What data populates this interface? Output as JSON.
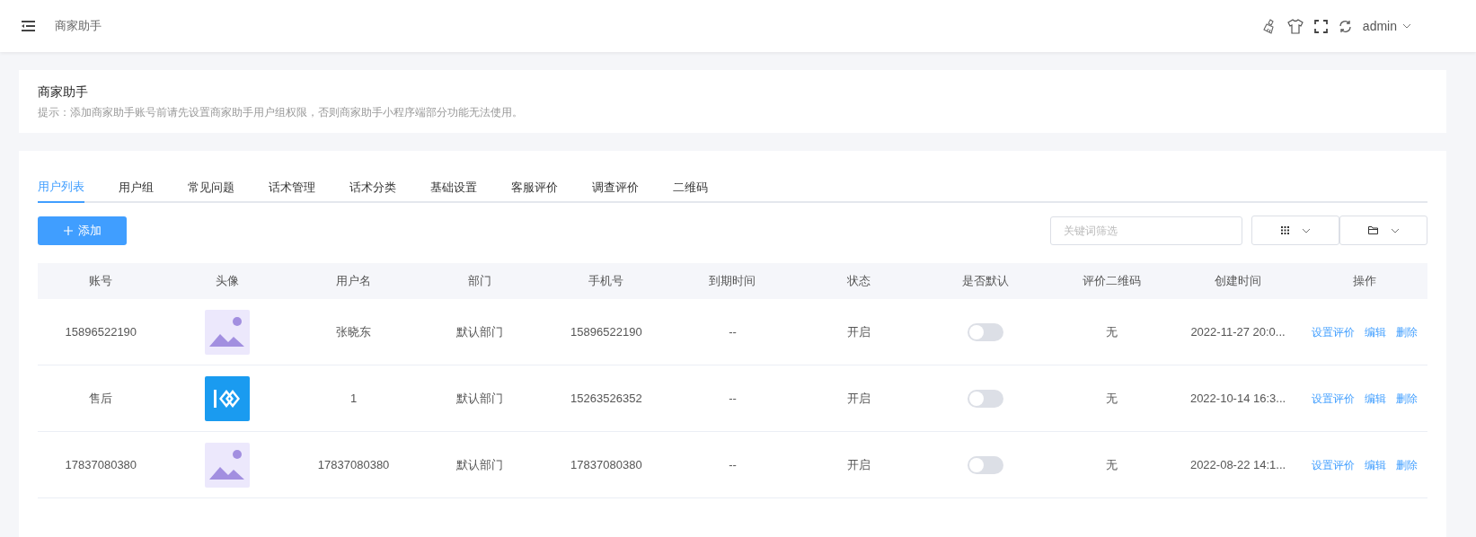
{
  "header": {
    "breadcrumb": "商家助手",
    "user": "admin"
  },
  "notice": {
    "title": "商家助手",
    "text": "提示：添加商家助手账号前请先设置商家助手用户组权限，否则商家助手小程序端部分功能无法使用。"
  },
  "tabs": [
    {
      "label": "用户列表",
      "selected": true
    },
    {
      "label": "用户组",
      "selected": false
    },
    {
      "label": "常见问题",
      "selected": false
    },
    {
      "label": "话术管理",
      "selected": false
    },
    {
      "label": "话术分类",
      "selected": false
    },
    {
      "label": "基础设置",
      "selected": false
    },
    {
      "label": "客服评价",
      "selected": false
    },
    {
      "label": "调查评价",
      "selected": false
    },
    {
      "label": "二维码",
      "selected": false
    }
  ],
  "toolbar": {
    "add_button": "添加",
    "search": {
      "placeholder": "关键词筛选"
    }
  },
  "table": {
    "columns": [
      "账号",
      "头像",
      "用户名",
      "部门",
      "手机号",
      "到期时间",
      "状态",
      "是否默认",
      "评价二维码",
      "创建时间",
      "操作"
    ],
    "rows": [
      {
        "account": "15896522190",
        "avatar": {
          "kind": "placeholder"
        },
        "username": "张晓东",
        "department": "默认部门",
        "phone": "15896522190",
        "expiry": "--",
        "status": "开启",
        "default_on": false,
        "qr": "无",
        "created": "2022-11-27 20:0...",
        "actions": [
          "设置评价",
          "编辑",
          "删除"
        ]
      },
      {
        "account": "售后",
        "avatar": {
          "kind": "logo"
        },
        "username": "1",
        "department": "默认部门",
        "phone": "15263526352",
        "expiry": "--",
        "status": "开启",
        "default_on": false,
        "qr": "无",
        "created": "2022-10-14 16:3...",
        "actions": [
          "设置评价",
          "编辑",
          "删除"
        ]
      },
      {
        "account": "17837080380",
        "avatar": {
          "kind": "placeholder"
        },
        "username": "17837080380",
        "department": "默认部门",
        "phone": "17837080380",
        "expiry": "--",
        "status": "开启",
        "default_on": false,
        "qr": "无",
        "created": "2022-08-22 14:1...",
        "actions": [
          "设置评价",
          "编辑",
          "删除"
        ]
      }
    ]
  }
}
